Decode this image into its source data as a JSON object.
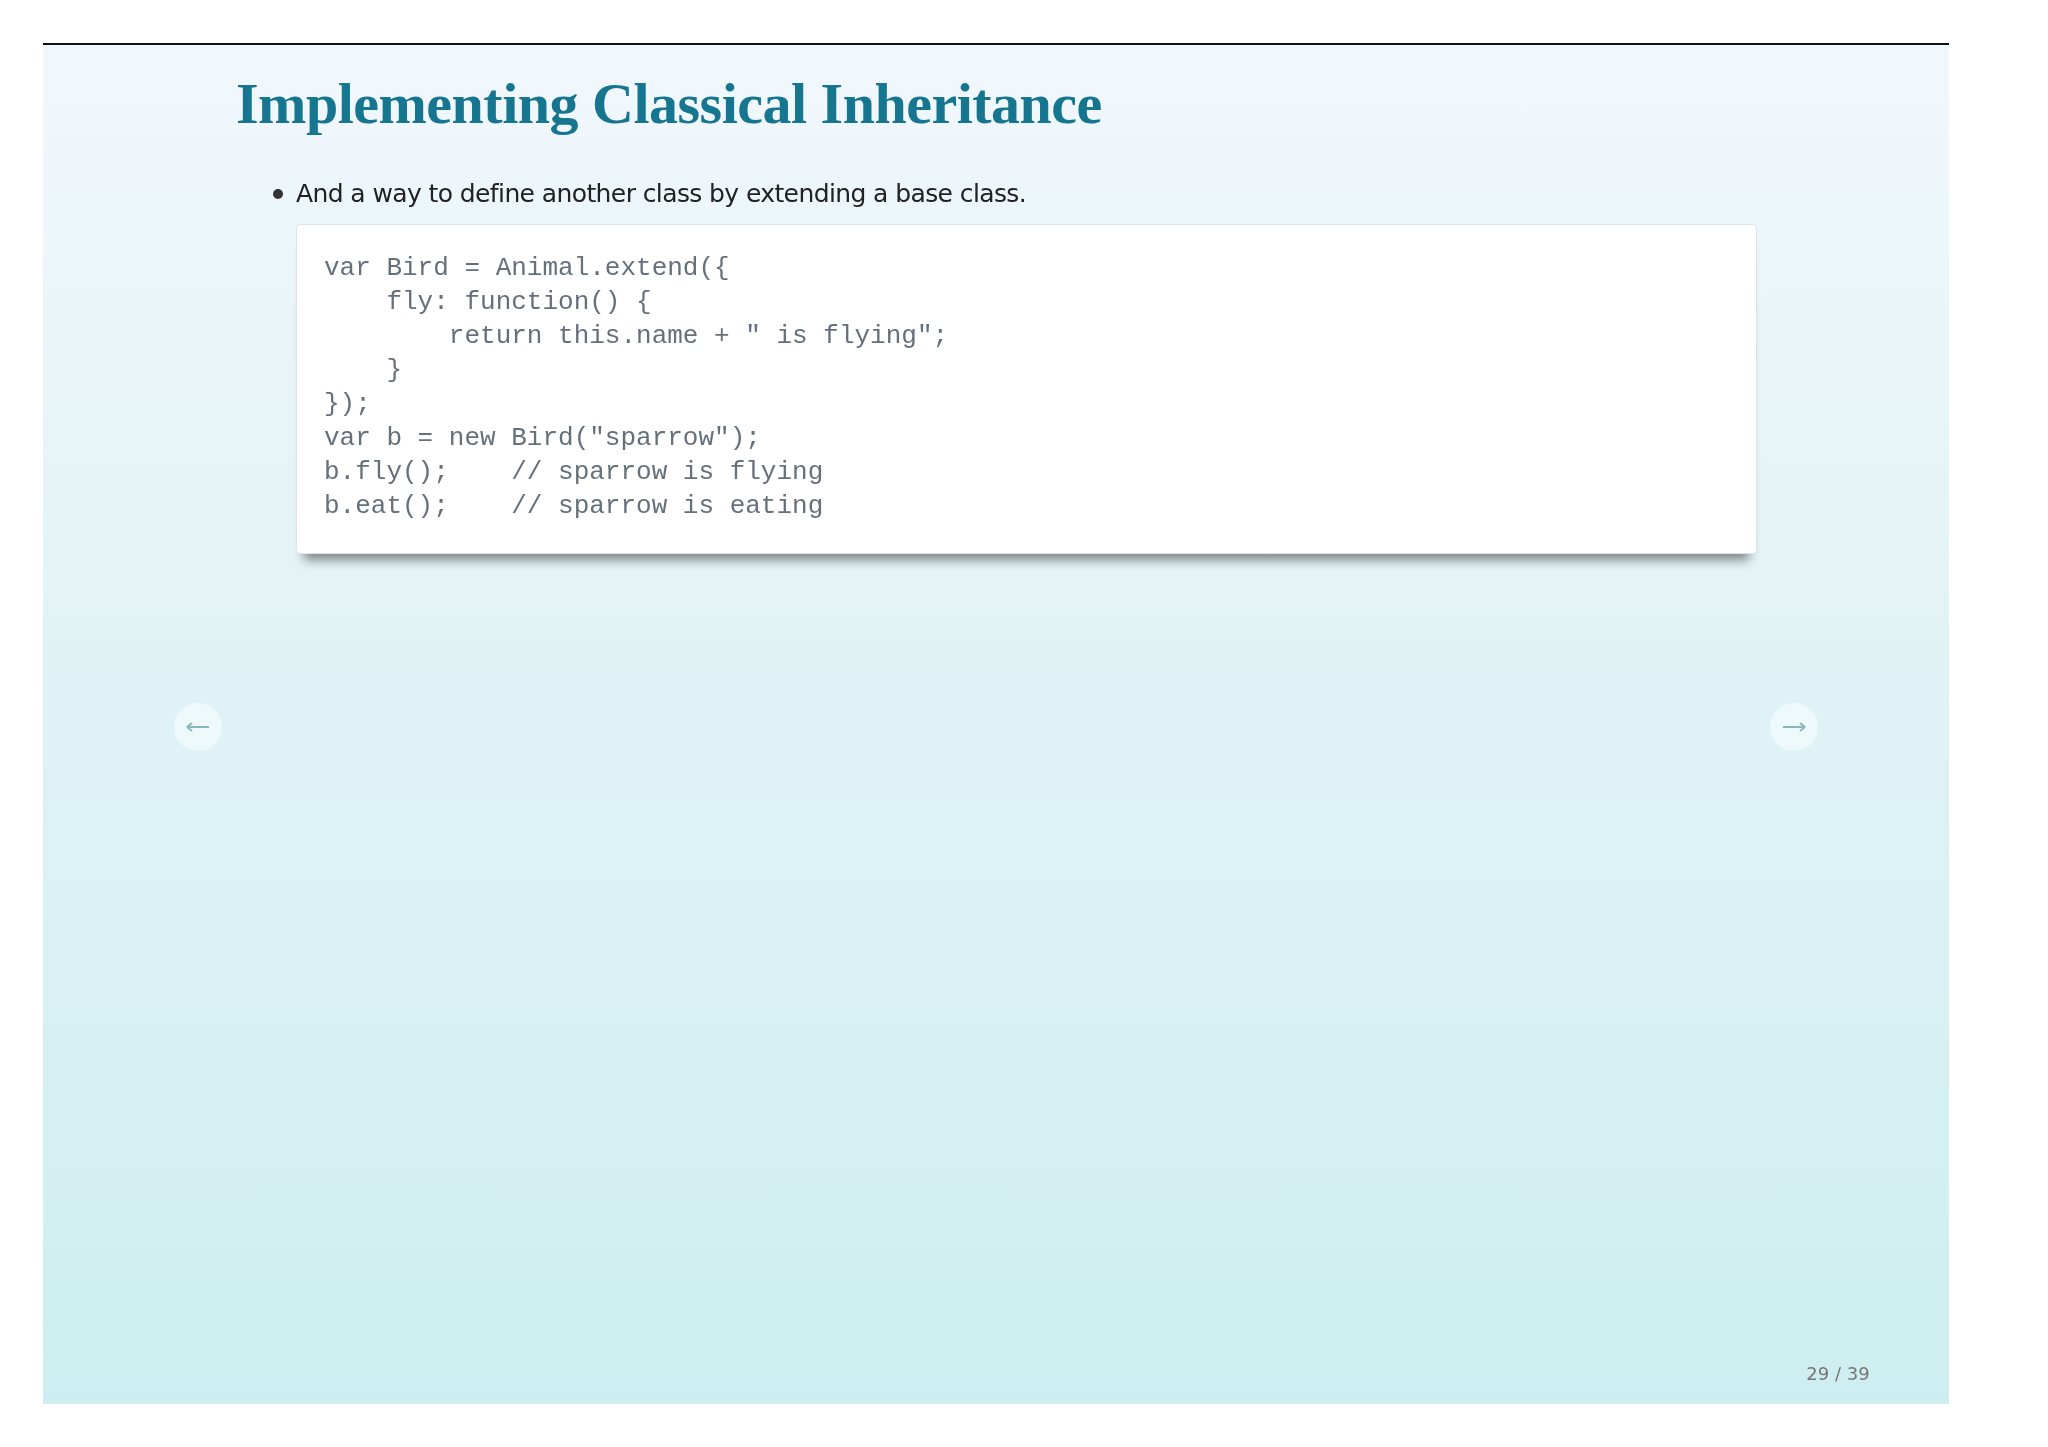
{
  "slide": {
    "title": "Implementing Classical Inheritance",
    "bullets": [
      "And a way to define another class by extending a base class."
    ],
    "code_lines": [
      "var Bird = Animal.extend({",
      "    fly: function() {",
      "        return this.name + \" is flying\";",
      "    }",
      "});",
      "var b = new Bird(\"sparrow\");",
      "b.fly();    // sparrow is flying",
      "b.eat();    // sparrow is eating"
    ],
    "page_number": "29 / 39"
  }
}
